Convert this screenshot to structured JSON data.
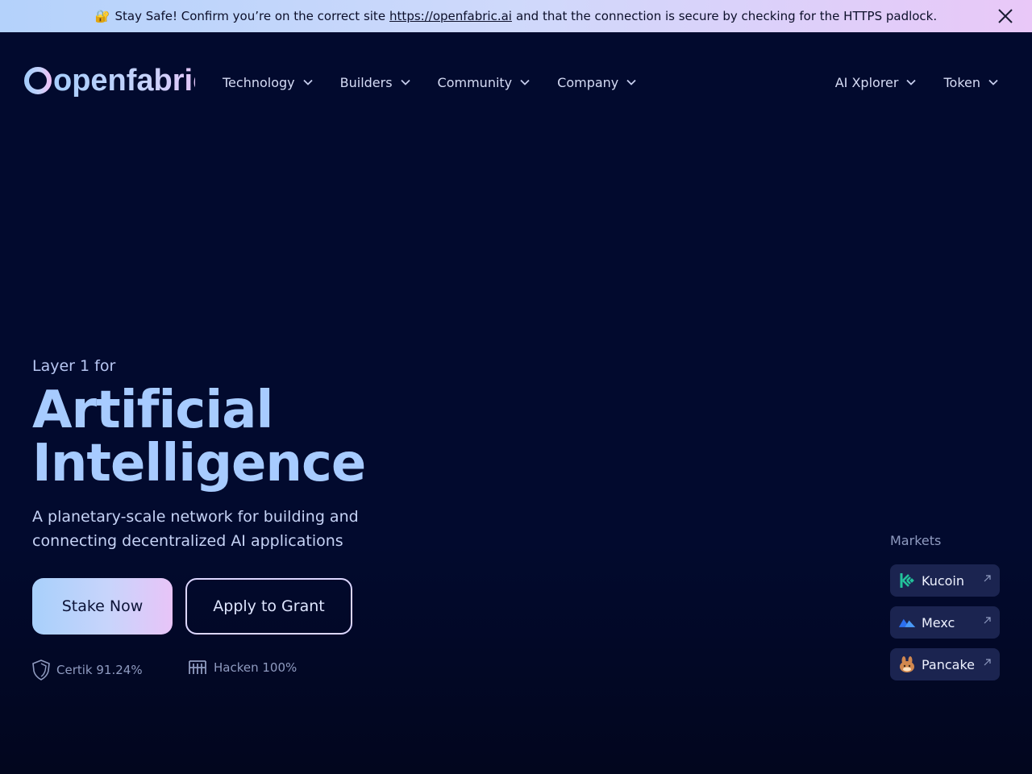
{
  "banner": {
    "lock_icon": "🔐",
    "text_before": "Stay Safe! Confirm you’re on the correct site",
    "link": "https://openfabric.ai",
    "text_after": "and that the connection is secure by checking for the HTTPS padlock."
  },
  "header": {
    "logo_text": "openfabric",
    "nav": [
      {
        "label": "Technology"
      },
      {
        "label": "Builders"
      },
      {
        "label": "Community"
      },
      {
        "label": "Company"
      }
    ],
    "nav_right": [
      {
        "label": "AI Xplorer"
      },
      {
        "label": "Token"
      }
    ]
  },
  "hero": {
    "eyebrow": "Layer 1 for",
    "title_line1": "Artificial",
    "title_line2": "Intelligence",
    "subtitle": "A planetary-scale network for building and connecting decentralized AI applications",
    "stake_button": "Stake Now",
    "grant_button": "Apply to Grant",
    "audits": [
      {
        "label": "Certik 91.24%",
        "icon": "shield-icon"
      },
      {
        "label": "Hacken 100%",
        "icon": "hacken-icon"
      }
    ]
  },
  "markets": {
    "label": "Markets",
    "items": [
      {
        "label": "Kucoin",
        "icon": "kucoin-icon"
      },
      {
        "label": "Mexc",
        "icon": "mexc-icon"
      },
      {
        "label": "Pancake",
        "icon": "pancake-icon"
      }
    ]
  },
  "colors": {
    "background": "#020a2e",
    "title": "#a7cbff",
    "accent_gradient_start": "#a8d0fb",
    "accent_gradient_end": "#e8c4f8",
    "market_card": "#1b2450"
  }
}
